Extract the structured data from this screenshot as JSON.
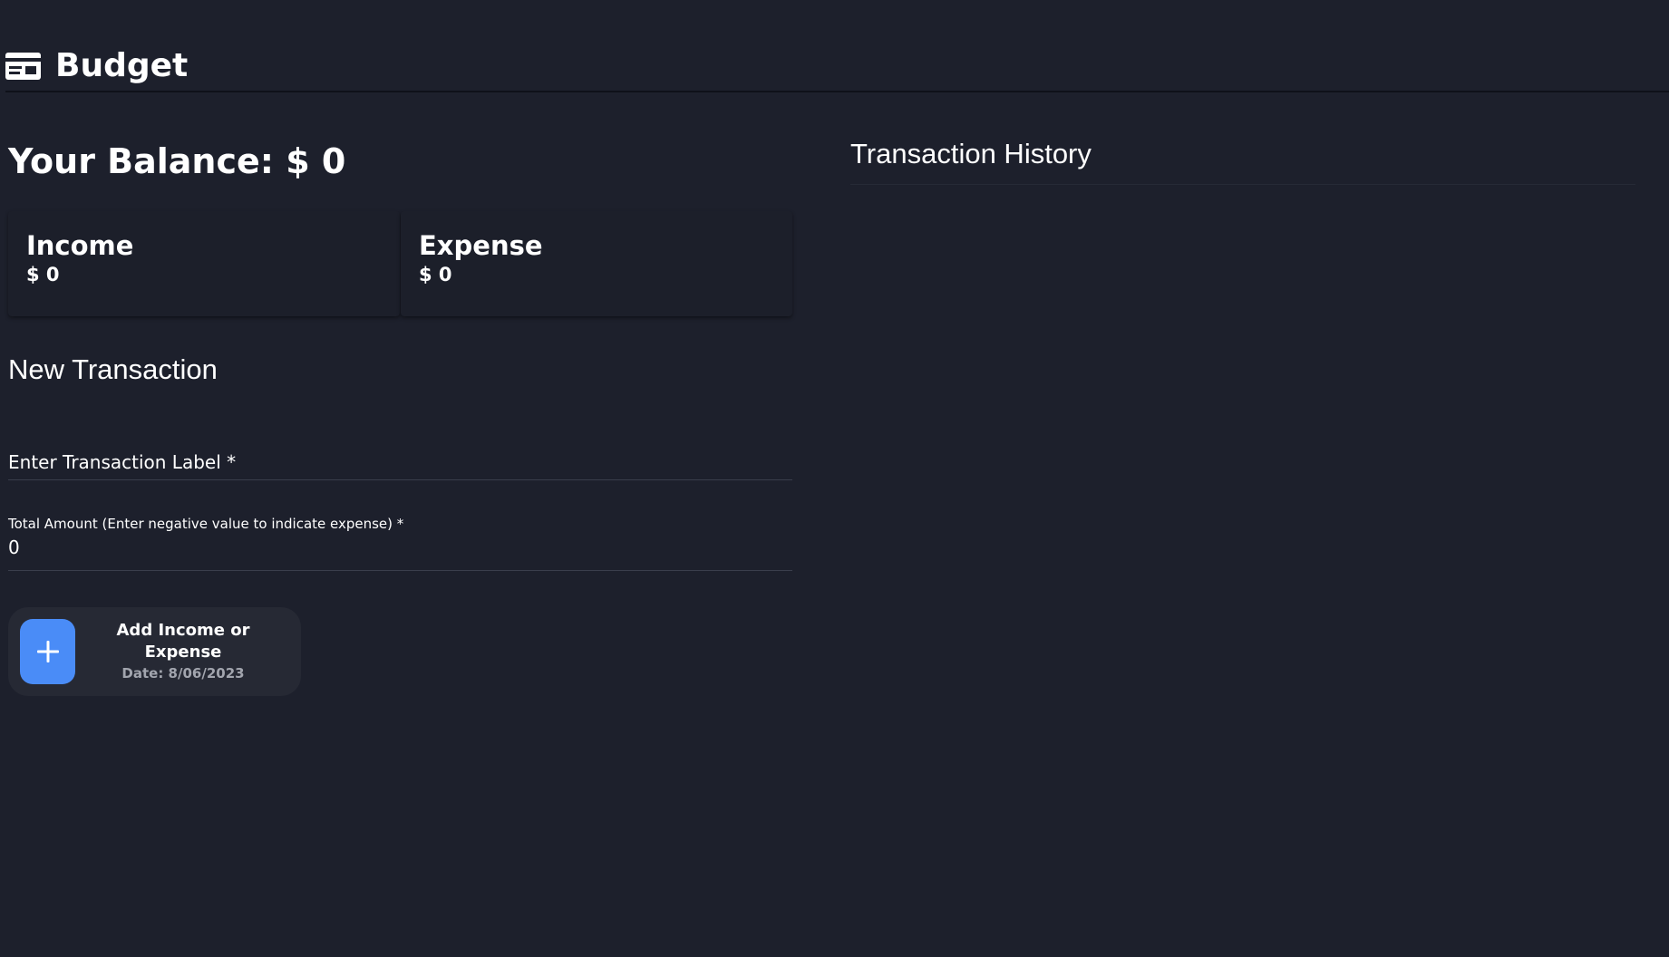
{
  "header": {
    "title": "Budget",
    "icon": "credit-card-icon"
  },
  "balance": {
    "text": "Your Balance: $ 0"
  },
  "cards": {
    "income": {
      "title": "Income",
      "value": "$ 0"
    },
    "expense": {
      "title": "Expense",
      "value": "$ 0"
    }
  },
  "new_transaction": {
    "title": "New Transaction",
    "label_field": {
      "placeholder": "Enter Transaction Label *"
    },
    "amount_field": {
      "label": "Total Amount (Enter negative value to indicate expense) *",
      "value": "0"
    },
    "add_button": {
      "icon": "plus-icon",
      "label": "Add Income or Expense",
      "date": "Date: 8/06/2023"
    }
  },
  "history": {
    "title": "Transaction History"
  },
  "colors": {
    "background": "#1d202c",
    "accent": "#4a8cf7",
    "button_bg": "#262934",
    "muted_text": "#a2a5ae"
  }
}
